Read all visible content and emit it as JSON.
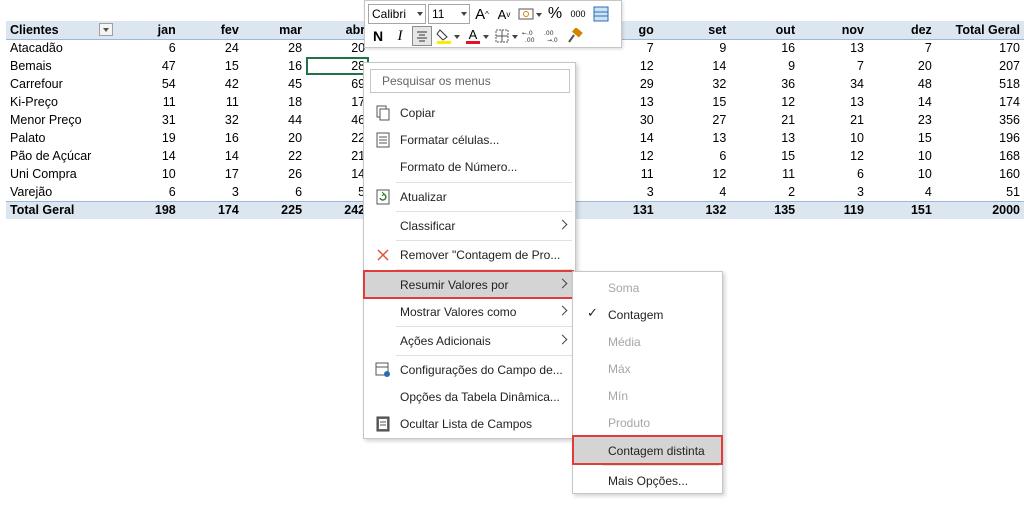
{
  "table": {
    "headers": [
      "Clientes",
      "jan",
      "fev",
      "mar",
      "abr",
      "go",
      "set",
      "out",
      "nov",
      "dez",
      "Total Geral"
    ],
    "rows": [
      [
        "Atacadão",
        "6",
        "24",
        "28",
        "20",
        "7",
        "9",
        "16",
        "13",
        "7",
        "170"
      ],
      [
        "Bemais",
        "47",
        "15",
        "16",
        "28",
        "12",
        "14",
        "9",
        "7",
        "20",
        "207"
      ],
      [
        "Carrefour",
        "54",
        "42",
        "45",
        "69",
        "29",
        "32",
        "36",
        "34",
        "48",
        "518"
      ],
      [
        "Ki-Preço",
        "11",
        "11",
        "18",
        "17",
        "13",
        "15",
        "12",
        "13",
        "14",
        "174"
      ],
      [
        "Menor Preço",
        "31",
        "32",
        "44",
        "46",
        "30",
        "27",
        "21",
        "21",
        "23",
        "356"
      ],
      [
        "Palato",
        "19",
        "16",
        "20",
        "22",
        "14",
        "13",
        "13",
        "10",
        "15",
        "196"
      ],
      [
        "Pão de Açúcar",
        "14",
        "14",
        "22",
        "21",
        "12",
        "6",
        "15",
        "12",
        "10",
        "168"
      ],
      [
        "Uni Compra",
        "10",
        "17",
        "26",
        "14",
        "11",
        "12",
        "11",
        "6",
        "10",
        "160"
      ],
      [
        "Varejão",
        "6",
        "3",
        "6",
        "5",
        "3",
        "4",
        "2",
        "3",
        "4",
        "51"
      ]
    ],
    "total": [
      "Total Geral",
      "198",
      "174",
      "225",
      "242",
      "131",
      "132",
      "135",
      "119",
      "151",
      "2000"
    ]
  },
  "mini_toolbar": {
    "font_name": "Calibri",
    "font_size": "11",
    "increase_font": "A",
    "decrease_font": "A",
    "percent": "%",
    "thousands": "000",
    "bold": "N",
    "italic": "I",
    "font_color_letter": "A"
  },
  "context_menu": {
    "search_placeholder": "Pesquisar os menus",
    "items": {
      "copiar": "Copiar",
      "formatar": "Formatar células...",
      "formato_numero": "Formato de Número...",
      "atualizar": "Atualizar",
      "classificar": "Classificar",
      "remover": "Remover \"Contagem de Pro...",
      "resumir": "Resumir Valores por",
      "mostrar": "Mostrar Valores como",
      "acoes": "Ações Adicionais",
      "config": "Configurações do Campo de...",
      "opcoes": "Opções da Tabela Dinâmica...",
      "ocultar": "Ocultar Lista de Campos"
    }
  },
  "submenu": {
    "items": [
      "Soma",
      "Contagem",
      "Média",
      "Máx",
      "Mín",
      "Produto",
      "Contagem distinta",
      "Mais Opções..."
    ],
    "checked": "Contagem"
  },
  "colors": {
    "header_fill": "#dce6f1",
    "highlight_frame": "#e03c3c",
    "selection_border": "#217346",
    "font_color_bar": "#e81123",
    "fill_color_bar": "#ffeb00"
  }
}
